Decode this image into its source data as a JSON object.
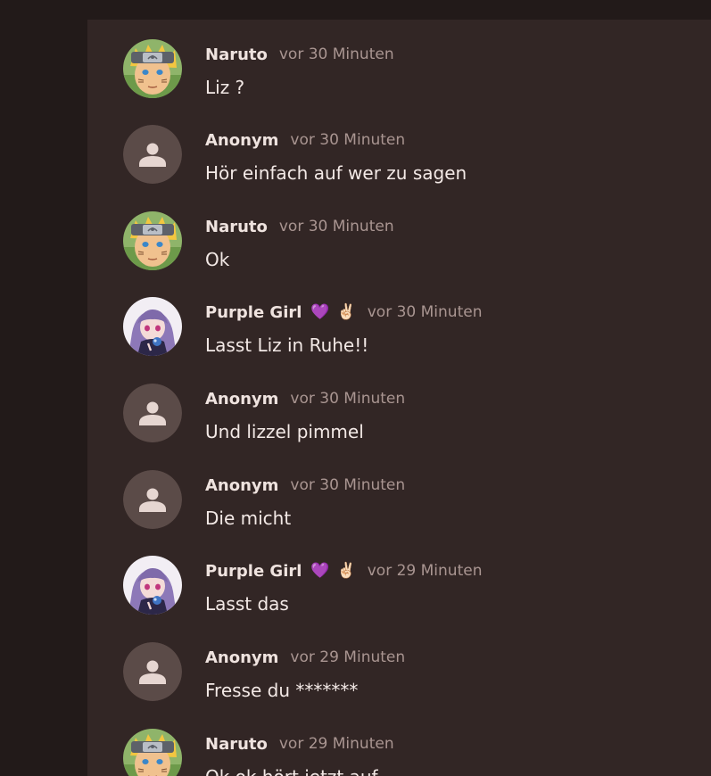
{
  "messages": [
    {
      "avatar": "naruto-avatar",
      "user": "Naruto",
      "badges": [],
      "time": "vor 30 Minuten",
      "text": "Liz ?"
    },
    {
      "avatar": "anonymous-avatar",
      "user": "Anonym",
      "badges": [],
      "time": "vor 30 Minuten",
      "text": "Hör einfach auf wer zu sagen"
    },
    {
      "avatar": "naruto-avatar",
      "user": "Naruto",
      "badges": [],
      "time": "vor 30 Minuten",
      "text": "Ok"
    },
    {
      "avatar": "purple-girl-avatar",
      "user": "Purple Girl",
      "badges": [
        "💜",
        "✌🏻"
      ],
      "time": "vor 30 Minuten",
      "text": "Lasst Liz in Ruhe!!"
    },
    {
      "avatar": "anonymous-avatar",
      "user": "Anonym",
      "badges": [],
      "time": "vor 30 Minuten",
      "text": "Und lizzel pimmel"
    },
    {
      "avatar": "anonymous-avatar",
      "user": "Anonym",
      "badges": [],
      "time": "vor 30 Minuten",
      "text": "Die micht"
    },
    {
      "avatar": "purple-girl-avatar",
      "user": "Purple Girl",
      "badges": [
        "💜",
        "✌🏻"
      ],
      "time": "vor 29 Minuten",
      "text": "Lasst das"
    },
    {
      "avatar": "anonymous-avatar",
      "user": "Anonym",
      "badges": [],
      "time": "vor 29 Minuten",
      "text": "Fresse du *******"
    },
    {
      "avatar": "naruto-avatar",
      "user": "Naruto",
      "badges": [],
      "time": "vor 29 Minuten",
      "text": "Ok ok hört jetzt auf"
    }
  ],
  "colors": {
    "page_background": "#221a19",
    "panel_background": "#322625",
    "username": "#efe3df",
    "timestamp": "#a99591",
    "message_text": "#f3e9e6",
    "anonymous_avatar_bg": "#5b4b48",
    "anonymous_avatar_icon": "#e6d6d1"
  }
}
